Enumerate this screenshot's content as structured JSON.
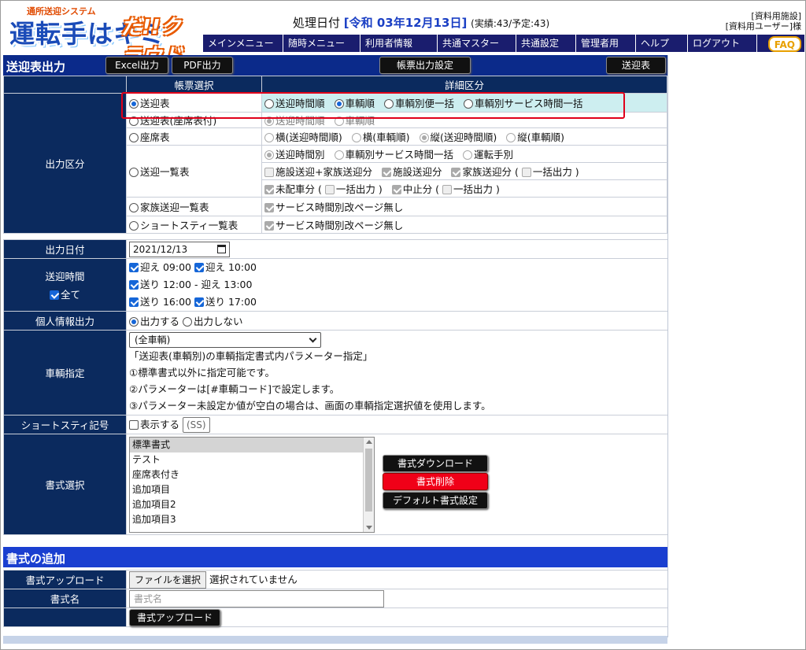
{
  "header": {
    "logo_sub": "通所送迎システム",
    "logo_main": "運転手はキミ",
    "logo_cloud": "だ!!クラウド",
    "proc_label": "処理日付",
    "proc_date": "[令和 03年12月13日]",
    "proc_count": "(実績:43/予定:43)",
    "facility": "[資料用施設]",
    "user": "[資料用ユーザー]様"
  },
  "menu": [
    "メインメニュー",
    "随時メニュー",
    "利用者情報",
    "共通マスター",
    "共通設定",
    "管理者用",
    "ヘルプ",
    "ログアウト"
  ],
  "faq": "FAQ",
  "titlebar": {
    "title": "送迎表出力",
    "excel": "Excel出力",
    "pdf": "PDF出力",
    "settings": "帳票出力設定",
    "right": "送迎表"
  },
  "table_headers": {
    "select": "帳票選択",
    "detail": "詳細区分"
  },
  "labels": {
    "output_kind": "出力区分",
    "output_date": "出力日付",
    "pickup_time": "送迎時間",
    "all": "全て",
    "personal": "個人情報出力",
    "vehicle": "車輌指定",
    "short_stay": "ショートスティ記号",
    "format_select": "書式選択"
  },
  "report_types": {
    "r1": "送迎表",
    "r2": "送迎表(座席表付)",
    "r3": "座席表",
    "r4": "送迎一覧表",
    "r5": "家族送迎一覧表",
    "r6": "ショートスティ一覧表"
  },
  "detail": {
    "r1": [
      "送迎時間順",
      "車輌順",
      "車輌別便一括",
      "車輌別サービス時間一括"
    ],
    "r2": [
      "送迎時間順",
      "車輌順"
    ],
    "r3": [
      "横(送迎時間順)",
      "横(車輌順)",
      "縦(送迎時間順)",
      "縦(車輌順)"
    ],
    "r4_line1": [
      "送迎時間別",
      "車輌別サービス時間一括",
      "運転手別"
    ],
    "r4_line2": [
      "施設送迎+家族送迎分",
      "施設送迎分",
      "家族送迎分 (",
      "一括出力 )"
    ],
    "r4_line3": [
      "未配車分 (",
      "一括出力 )",
      "中止分 (",
      "一括出力 )"
    ],
    "r5": "サービス時間別改ページ無し",
    "r6": "サービス時間別改ページ無し"
  },
  "date_value": "2021/12/13",
  "times": [
    "迎え 09:00",
    "迎え 10:00",
    "送り 12:00 - 迎え 13:00",
    "送り 16:00",
    "送り 17:00"
  ],
  "personal_options": [
    "出力する",
    "出力しない"
  ],
  "vehicle": {
    "selected": "(全車輌)",
    "note1": "「送迎表(車輌別)の車輌指定書式内パラメーター指定」",
    "note2": "①標準書式以外に指定可能です。",
    "note3": "②パラメーターは[#車輌コード]で設定します。",
    "note4": "③パラメーター未設定か値が空白の場合は、画面の車輌指定選択値を使用します。"
  },
  "short_stay": {
    "show": "表示する",
    "code": "(SS)"
  },
  "formats": [
    "標準書式",
    "テスト",
    "座席表付き",
    "追加項目",
    "追加項目2",
    "追加項目3"
  ],
  "format_buttons": {
    "download": "書式ダウンロード",
    "delete": "書式削除",
    "default": "デフォルト書式設定"
  },
  "add_section": {
    "title": "書式の追加",
    "upload_label": "書式アップロード",
    "file_button": "ファイルを選択",
    "file_status": "選択されていません",
    "name_label": "書式名",
    "name_placeholder": "書式名",
    "upload_button": "書式アップロード"
  },
  "colors": {
    "nav": "#0b2a5e",
    "accent": "#1a3fc4",
    "delete": "#e0001a",
    "highlight": "#cdeef0"
  }
}
